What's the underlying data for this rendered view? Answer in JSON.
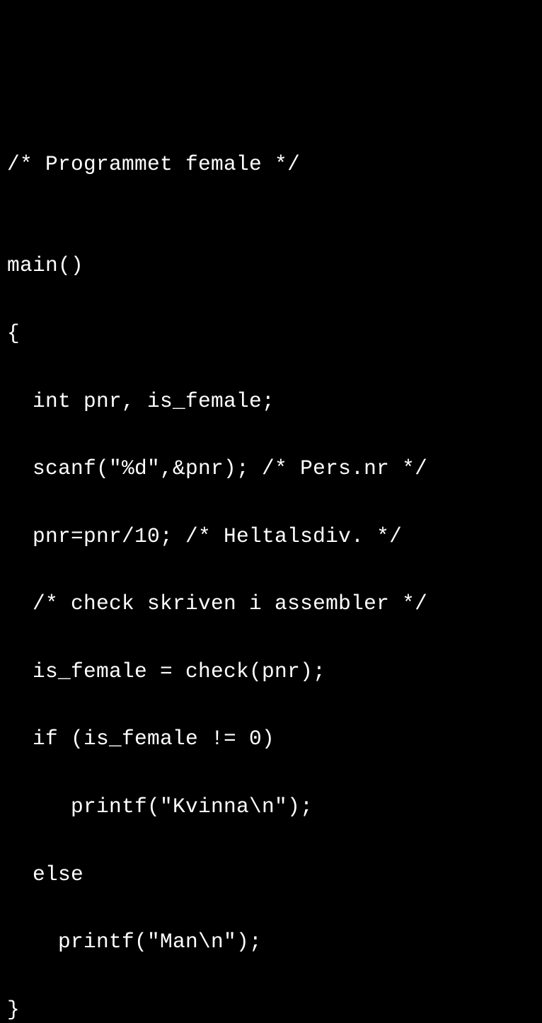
{
  "code": {
    "lines": [
      "/* Programmet female */",
      "",
      "main()",
      "{",
      "  int pnr, is_female;",
      "  scanf(\"%d\",&pnr); /* Pers.nr */",
      "  pnr=pnr/10; /* Heltalsdiv. */",
      "  /* check skriven i assembler */",
      "  is_female = check(pnr);",
      "  if (is_female != 0)",
      "     printf(\"Kvinna\\n\");",
      "  else",
      "    printf(\"Man\\n\");",
      "}"
    ]
  }
}
